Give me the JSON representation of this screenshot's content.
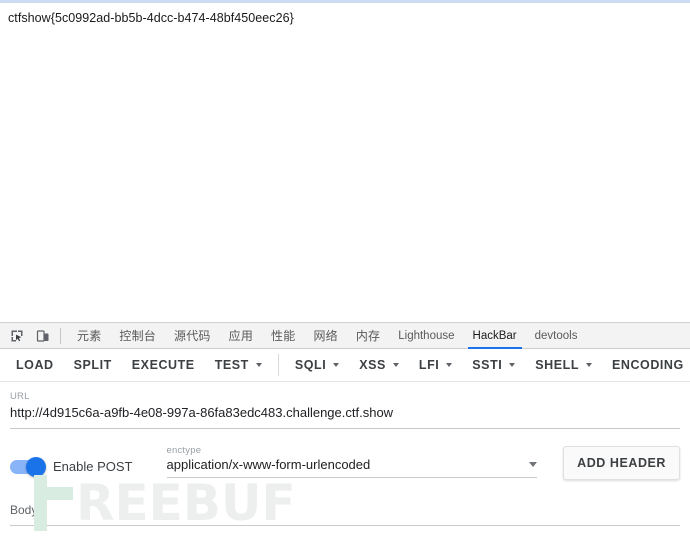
{
  "page": {
    "flag_text": "ctfshow{5c0992ad-bb5b-4dcc-b474-48bf450eec26}"
  },
  "devtools": {
    "icons": {
      "inspect": "inspect-element-icon",
      "device": "device-toolbar-icon"
    },
    "tabs": [
      {
        "label": "元素",
        "active": false,
        "cjk": true
      },
      {
        "label": "控制台",
        "active": false,
        "cjk": true
      },
      {
        "label": "源代码",
        "active": false,
        "cjk": true
      },
      {
        "label": "应用",
        "active": false,
        "cjk": true
      },
      {
        "label": "性能",
        "active": false,
        "cjk": true
      },
      {
        "label": "网络",
        "active": false,
        "cjk": true
      },
      {
        "label": "内存",
        "active": false,
        "cjk": true
      },
      {
        "label": "Lighthouse",
        "active": false,
        "cjk": false
      },
      {
        "label": "HackBar",
        "active": true,
        "cjk": false
      },
      {
        "label": "devtools",
        "active": false,
        "cjk": false
      }
    ]
  },
  "hackbar": {
    "toolbar": {
      "load": "LOAD",
      "split": "SPLIT",
      "execute": "EXECUTE",
      "test": "TEST",
      "sqli": "SQLI",
      "xss": "XSS",
      "lfi": "LFI",
      "ssti": "SSTI",
      "shell": "SHELL",
      "encoding": "ENCODING"
    },
    "url": {
      "label": "URL",
      "value": "http://4d915c6a-a9fb-4e08-997a-86fa83edc483.challenge.ctf.show"
    },
    "post": {
      "toggle_label": "Enable POST",
      "toggle_on": true,
      "enctype_label": "enctype",
      "enctype_value": "application/x-www-form-urlencoded",
      "add_header_label": "ADD HEADER"
    },
    "body": {
      "label": "Body",
      "value": ""
    }
  },
  "watermark": {
    "text": "REEBUF"
  },
  "colors": {
    "accent": "#1a73e8",
    "toggle_track": "#8ab4f8",
    "tab_active_underline": "#1a73e8",
    "watermark_mark": "#d9ece1",
    "watermark_text": "#edefee"
  }
}
